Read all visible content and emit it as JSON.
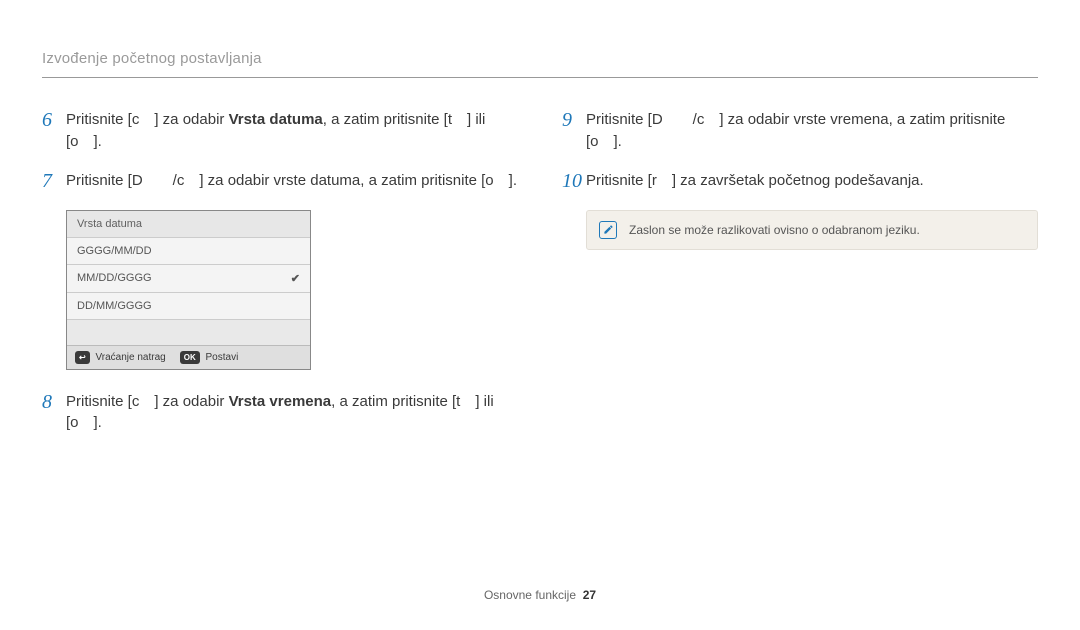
{
  "header": "Izvođenje početnog postavljanja",
  "left": {
    "step6": {
      "num": "6",
      "pre": "Pritisnite [c ] za odabir ",
      "bold": "Vrsta datuma",
      "post": ", a zatim pritisnite [t ] ili [o ]."
    },
    "step7": {
      "num": "7",
      "text": "Pritisnite [D  /c ] za odabir vrste datuma, a zatim pritisnite [o ]."
    },
    "menu": {
      "title": "Vrsta datuma",
      "opt1": "GGGG/MM/DD",
      "opt2": "MM/DD/GGGG",
      "opt3": "DD/MM/GGGG",
      "back_key": "↩",
      "back_label": "Vraćanje natrag",
      "ok_key": "OK",
      "ok_label": "Postavi"
    },
    "step8": {
      "num": "8",
      "pre": "Pritisnite [c ] za odabir ",
      "bold": "Vrsta vremena",
      "post": ", a zatim pritisnite [t ] ili [o ]."
    }
  },
  "right": {
    "step9": {
      "num": "9",
      "text": "Pritisnite [D  /c ] za odabir vrste vremena, a zatim pritisnite [o ]."
    },
    "step10": {
      "num": "10",
      "text": "Pritisnite [r ] za završetak početnog podešavanja."
    },
    "note": "Zaslon se može razlikovati ovisno o odabranom jeziku."
  },
  "footer": {
    "label": "Osnovne funkcije",
    "page": "27"
  }
}
